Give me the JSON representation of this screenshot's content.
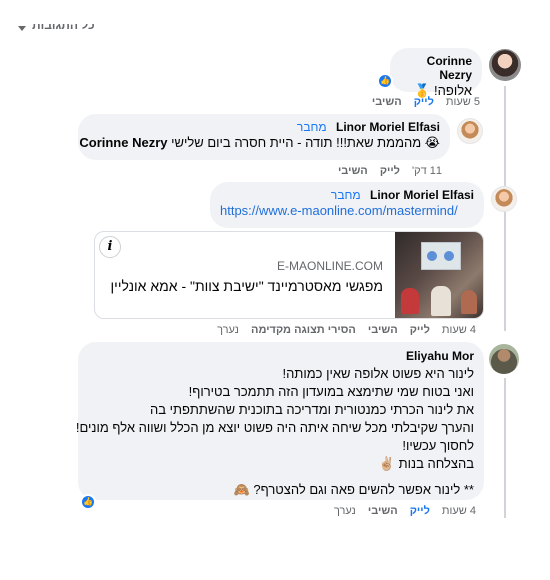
{
  "header": {
    "label": "כל התגובות"
  },
  "comments": [
    {
      "author": "Corinne Nezry",
      "text": "אלופה! 🥇",
      "time": "5 שעות",
      "like": "לייק",
      "reply": "השיבי",
      "reaction": "like-icon"
    },
    {
      "author": "Linor Moriel Elfasi",
      "badge": "מחבר",
      "text": "😭 מהממת שאת!!! תודה - היית חסרה ביום שלישי",
      "mention": "Corinne Nezry",
      "time": "11 דק'",
      "like": "לייק",
      "reply": "השיבי"
    },
    {
      "author": "Linor Moriel Elfasi",
      "badge": "מחבר",
      "link": "https://www.e-maonline.com/mastermind/",
      "preview": {
        "domain": "E-MAONLINE.COM",
        "title": "מפגשי מאסטרמיינד \"ישיבת צוות\" - אמא אונליין"
      },
      "time": "4 שעות",
      "like": "לייק",
      "reply": "השיבי",
      "remove_preview": "הסירי תצוגה מקדימה",
      "edited": "נערך"
    },
    {
      "author": "Eliyahu Mor",
      "lines": [
        "לינור היא פשוט אלופה שאין כמותה!",
        "ואני בטוח שמי שתימצא במועדון הזה תתמכר בטירוף!",
        "את לינור הכרתי כמנטורית ומדריכה בתוכנית שהשתתפתי בה",
        "והערך שקיבלתי מכל שיחה איתה היה פשוט יוצא מן הכלל ושווה אלף מונים!",
        "לחסוך עכשיו!",
        "בהצלחה בנות ✌🏼",
        "",
        "** לינור אפשר להשים פאה וגם להצטרף? 🙈"
      ],
      "time": "4 שעות",
      "like": "לייק",
      "reply": "השיבי",
      "edited": "נערך",
      "reaction": "like-icon"
    }
  ],
  "colors": {
    "accent": "#1877f2",
    "bubble": "#f0f2f5",
    "meta": "#65676b"
  }
}
